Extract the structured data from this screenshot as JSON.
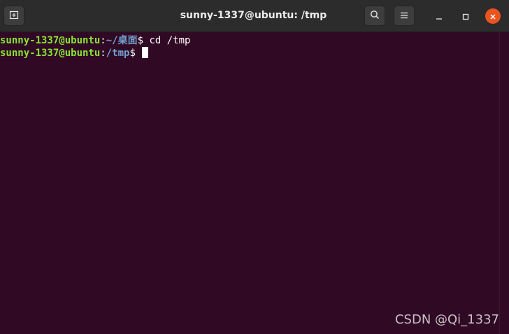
{
  "window": {
    "title": "sunny-1337@ubuntu: /tmp"
  },
  "toolbar": {
    "new_tab_icon": "new-tab-icon",
    "search_icon": "search-icon",
    "menu_icon": "hamburger-menu-icon"
  },
  "terminal": {
    "lines": [
      {
        "user": "sunny-1337@ubuntu",
        "sep": ":",
        "path": "~/桌面",
        "prompt": "$ ",
        "command": "cd /tmp"
      },
      {
        "user": "sunny-1337@ubuntu",
        "sep": ":",
        "path": "/tmp",
        "prompt": "$ ",
        "command": ""
      }
    ]
  },
  "colors": {
    "background": "#300a24",
    "user": "#8ae234",
    "path": "#729fcf",
    "close_button": "#e95420"
  },
  "watermark": "CSDN @Qi_1337"
}
